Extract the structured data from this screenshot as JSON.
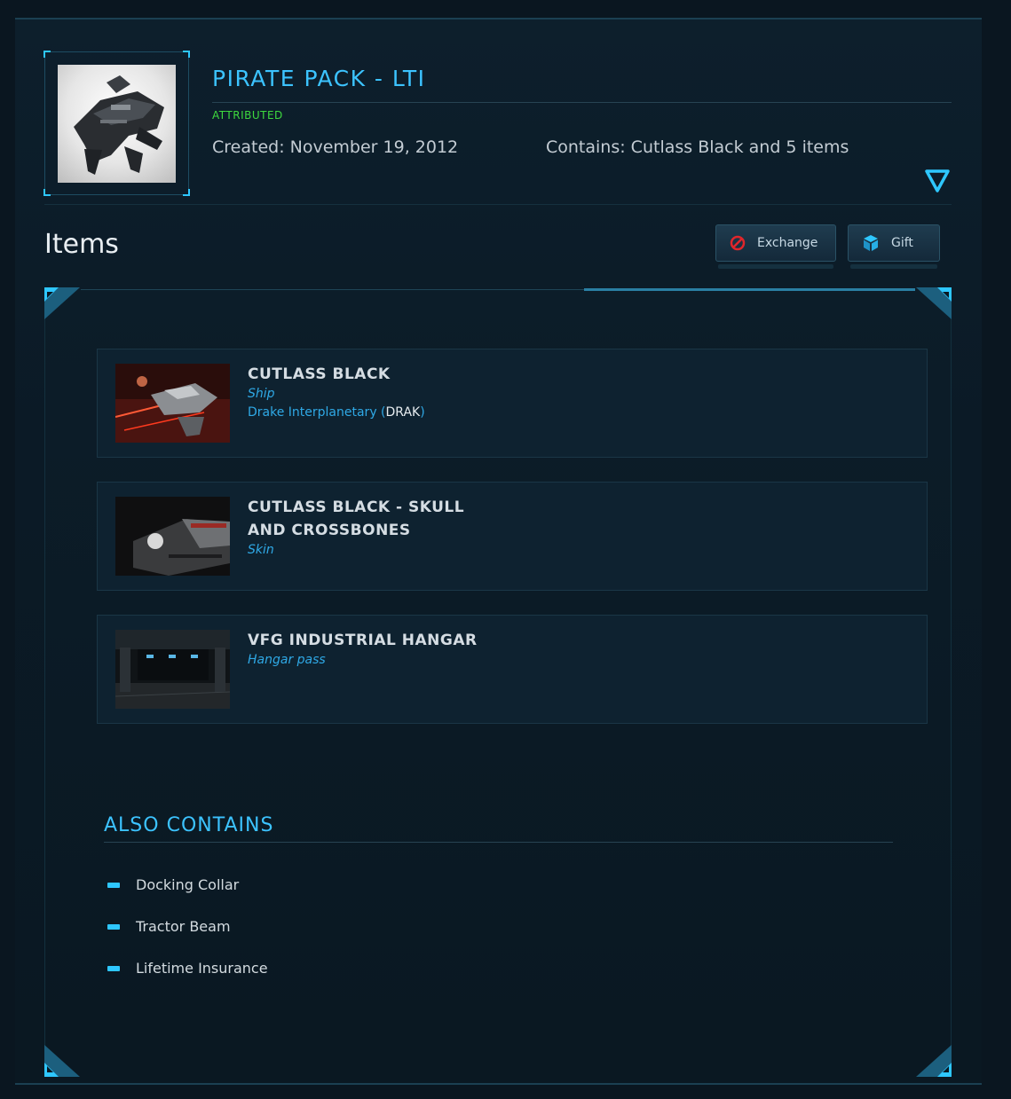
{
  "pledge": {
    "title": "PIRATE PACK - LTI",
    "status": "ATTRIBUTED",
    "created": "Created: November 19, 2012",
    "contains": "Contains: Cutlass Black and 5 items"
  },
  "section": {
    "items_heading": "Items"
  },
  "actions": {
    "exchange_label": "Exchange",
    "gift_label": "Gift"
  },
  "items": [
    {
      "title": "CUTLASS BLACK",
      "type": "Ship",
      "manufacturer": "Drake Interplanetary (",
      "manufacturer_code": "DRAK",
      "manufacturer_close": ")"
    },
    {
      "title": "CUTLASS BLACK - SKULL AND CROSSBONES",
      "type": "Skin"
    },
    {
      "title": "VFG INDUSTRIAL HANGAR",
      "type": "Hangar pass"
    }
  ],
  "also_contains": {
    "title": "ALSO CONTAINS",
    "entries": [
      "Docking Collar",
      "Tractor Beam",
      "Lifetime Insurance"
    ]
  },
  "colors": {
    "accent": "#3cc3ff",
    "status": "#3ed93e",
    "exchange_icon": "#e0262b",
    "gift_icon": "#2ec7ff"
  },
  "icons": {
    "expand": "triangle-down-icon",
    "exchange": "prohibited-icon",
    "gift": "cube-icon"
  }
}
